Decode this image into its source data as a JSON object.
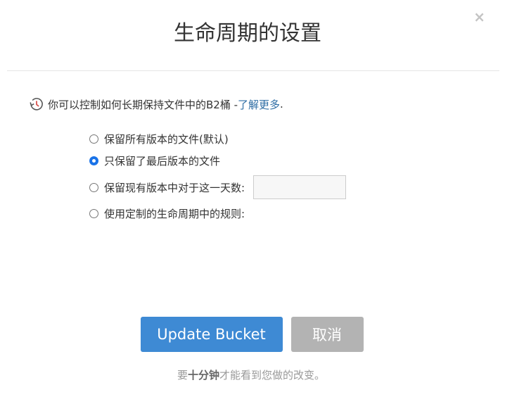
{
  "dialog": {
    "title": "生命周期的设置",
    "close_label": "×"
  },
  "intro": {
    "text": "你可以控制如何长期保持文件中的B2桶 - ",
    "link_label": "了解更多",
    "suffix": ".",
    "icon": "history-clock-icon"
  },
  "options": [
    {
      "label": "保留所有版本的文件(默认)",
      "checked": false
    },
    {
      "label": "只保留了最后版本的文件",
      "checked": true
    },
    {
      "label": "保留现有版本中对于这一天数:",
      "checked": false,
      "has_input": true
    },
    {
      "label": "使用定制的生命周期中的规则:",
      "checked": false
    }
  ],
  "days_input": {
    "value": "",
    "placeholder": ""
  },
  "buttons": {
    "update_label": "Update Bucket",
    "cancel_label": "取消"
  },
  "footer": {
    "prefix": "要",
    "bold": "十分钟",
    "suffix": "才能看到您做的改变。"
  },
  "colors": {
    "primary": "#3e8ad4",
    "cancel": "#b3b3b3",
    "link": "#2e6da4",
    "radio_checked": "#1a73e8"
  }
}
